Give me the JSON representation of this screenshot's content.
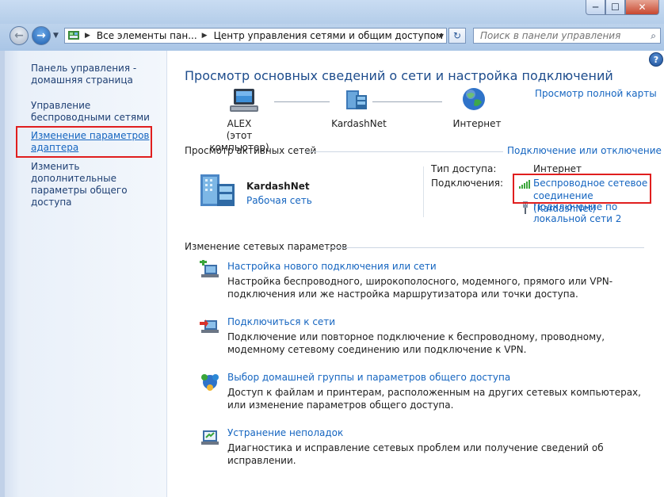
{
  "window": {
    "minimize_glyph": "─",
    "maximize_glyph": "☐",
    "close_glyph": "✕"
  },
  "navigation": {
    "breadcrumb": [
      "Все элементы пан...",
      "Центр управления сетями и общим доступом"
    ],
    "search_placeholder": "Поиск в панели управления"
  },
  "sidebar": {
    "items": [
      {
        "label": "Панель управления - домашняя страница"
      },
      {
        "label": "Управление беспроводными сетями"
      },
      {
        "label": "Изменение параметров адаптера"
      },
      {
        "label": "Изменить дополнительные параметры общего доступа"
      }
    ]
  },
  "main": {
    "title": "Просмотр основных сведений о сети и настройка подключений",
    "full_map_link": "Просмотр полной карты",
    "map": {
      "computer_name": "ALEX",
      "computer_sub": "(этот компьютер)",
      "network_name": "KardashNet",
      "internet_label": "Интернет"
    },
    "active_networks": {
      "header": "Просмотр активных сетей",
      "connect_link": "Подключение или отключение",
      "network_name": "KardashNet",
      "network_type": "Рабочая сеть",
      "access_label": "Тип доступа:",
      "access_value": "Интернет",
      "connections_label": "Подключения:",
      "connection_wireless": "Беспроводное сетевое соединение (KardashNet)",
      "connection_lan": "Подключение по локальной сети 2"
    },
    "change_settings": {
      "header": "Изменение сетевых параметров",
      "tasks": [
        {
          "title": "Настройка нового подключения или сети",
          "description": "Настройка беспроводного, широкополосного, модемного, прямого или VPN-подключения или же настройка маршрутизатора или точки доступа."
        },
        {
          "title": "Подключиться к сети",
          "description": "Подключение или повторное подключение к беспроводному, проводному, модемному сетевому соединению или подключение к VPN."
        },
        {
          "title": "Выбор домашней группы и параметров общего доступа",
          "description": "Доступ к файлам и принтерам, расположенным на других сетевых компьютерах, или изменение параметров общего доступа."
        },
        {
          "title": "Устранение неполадок",
          "description": "Диагностика и исправление сетевых проблем или получение сведений об исправлении."
        }
      ]
    }
  },
  "colors": {
    "link": "#1565c0",
    "title": "#1d4c8c",
    "highlight": "#e01e1e"
  }
}
